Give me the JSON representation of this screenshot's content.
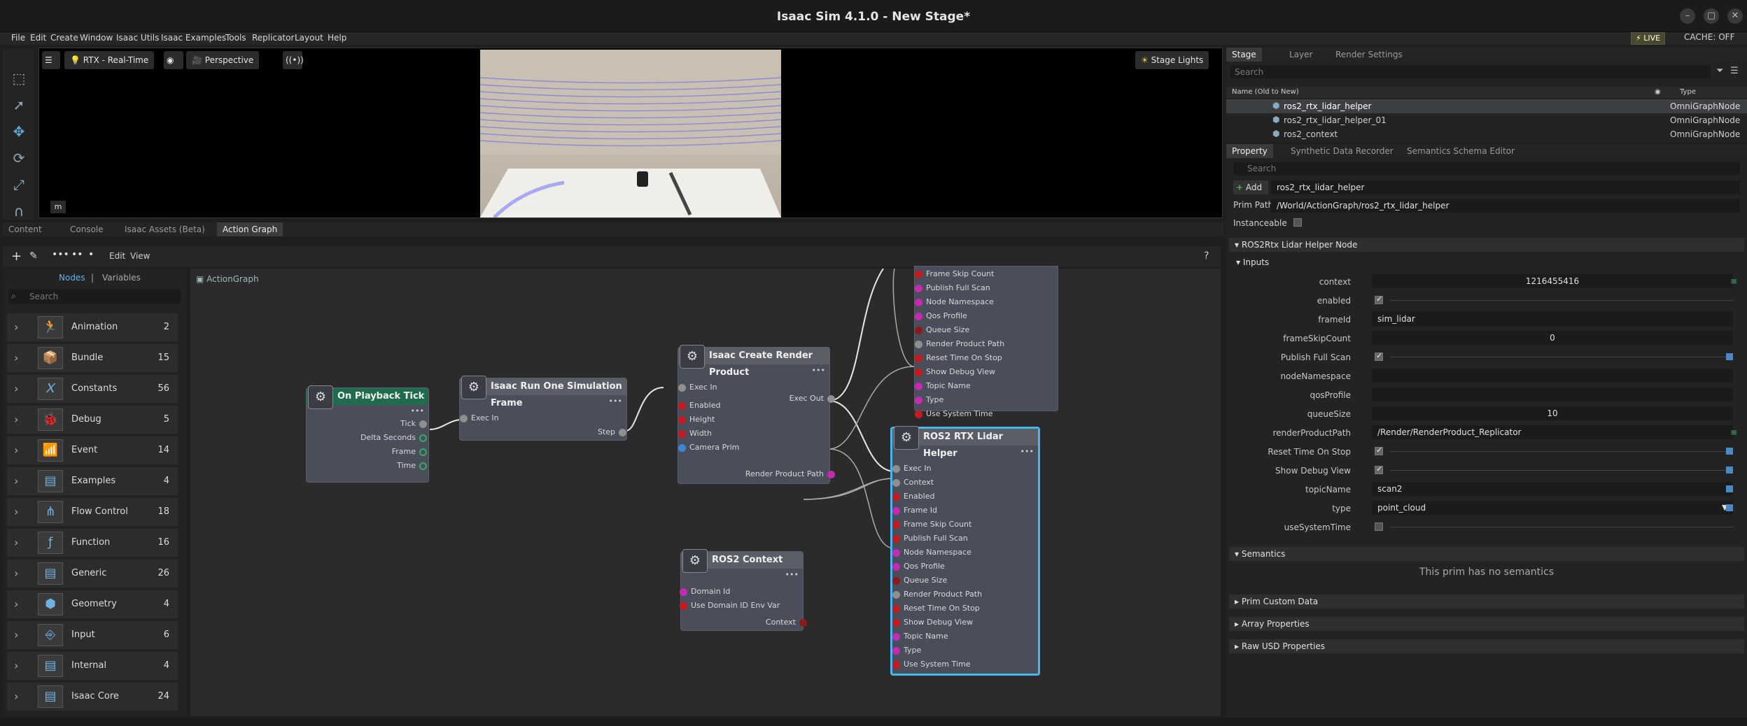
{
  "window": {
    "title": "Isaac Sim 4.1.0 - New Stage*"
  },
  "menu": [
    "File",
    "Edit",
    "Create",
    "Window",
    "Isaac Utils",
    "Isaac Examples",
    "Tools",
    "Replicator",
    "Layout",
    "Help"
  ],
  "status": {
    "live": "LIVE",
    "cache": "CACHE: OFF"
  },
  "viewport": {
    "render_mode": "RTX - Real-Time",
    "camera": "Perspective",
    "stage_lights": "Stage Lights",
    "units": "m"
  },
  "bottom_tabs": [
    "Content",
    "Console",
    "Isaac Assets (Beta)",
    "Action Graph"
  ],
  "graph": {
    "menus": [
      "Edit",
      "View"
    ],
    "lib_tabs": {
      "nodes": "Nodes",
      "vars": "Variables"
    },
    "search_placeholder": "Search",
    "breadcrumb": "ActionGraph",
    "help": "?",
    "categories": [
      {
        "name": "Animation",
        "count": "2"
      },
      {
        "name": "Bundle",
        "count": "15"
      },
      {
        "name": "Constants",
        "count": "56"
      },
      {
        "name": "Debug",
        "count": "5"
      },
      {
        "name": "Event",
        "count": "14"
      },
      {
        "name": "Examples",
        "count": "4"
      },
      {
        "name": "Flow Control",
        "count": "18"
      },
      {
        "name": "Function",
        "count": "16"
      },
      {
        "name": "Generic",
        "count": "26"
      },
      {
        "name": "Geometry",
        "count": "4"
      },
      {
        "name": "Input",
        "count": "6"
      },
      {
        "name": "Internal",
        "count": "4"
      },
      {
        "name": "Isaac Core",
        "count": "24"
      }
    ],
    "nodes": {
      "tick": {
        "title": "On Playback Tick",
        "outputs": [
          "Tick",
          "Delta Seconds",
          "Frame",
          "Time"
        ]
      },
      "sim": {
        "title": "Isaac Run One Simulation Frame",
        "inputs": [
          "Exec In"
        ],
        "outputs": [
          "Step"
        ]
      },
      "render": {
        "title": "Isaac Create Render Product",
        "inputs": [
          "Exec In",
          "Enabled",
          "Height",
          "Width",
          "Camera Prim"
        ],
        "outputs": [
          "Exec Out",
          "Render Product Path"
        ]
      },
      "ros2ctx": {
        "title": "ROS2 Context",
        "inputs": [
          "Domain Id",
          "Use Domain ID Env Var"
        ],
        "outputs": [
          "Context"
        ]
      },
      "lidar_top": {
        "inputs": [
          "Frame Skip Count",
          "Publish Full Scan",
          "Node Namespace",
          "Qos Profile",
          "Queue Size",
          "Render Product Path",
          "Reset Time On Stop",
          "Show Debug View",
          "Topic Name",
          "Type",
          "Use System Time"
        ]
      },
      "lidar": {
        "title": "ROS2 RTX Lidar Helper",
        "inputs": [
          "Exec In",
          "Context",
          "Enabled",
          "Frame Id",
          "Frame Skip Count",
          "Publish Full Scan",
          "Node Namespace",
          "Qos Profile",
          "Queue Size",
          "Render Product Path",
          "Reset Time On Stop",
          "Show Debug View",
          "Topic Name",
          "Type",
          "Use System Time"
        ]
      }
    }
  },
  "stage": {
    "tabs": [
      "Stage",
      "Layer",
      "Render Settings"
    ],
    "search_placeholder": "Search",
    "col_name": "Name (Old to New)",
    "col_type": "Type",
    "items": [
      {
        "name": "ros2_rtx_lidar_helper",
        "type": "OmniGraphNode"
      },
      {
        "name": "ros2_rtx_lidar_helper_01",
        "type": "OmniGraphNode"
      },
      {
        "name": "ros2_context",
        "type": "OmniGraphNode"
      }
    ]
  },
  "property": {
    "tabs": [
      "Property",
      "Synthetic Data Recorder",
      "Semantics Schema Editor"
    ],
    "search_placeholder": "Search",
    "add_label": "Add",
    "prim_name": "ros2_rtx_lidar_helper",
    "prim_path_label": "Prim Path",
    "prim_path": "/World/ActionGraph/ros2_rtx_lidar_helper",
    "instanceable_label": "Instanceable",
    "node_section": "ROS2Rtx Lidar Helper Node",
    "inputs_section": "Inputs",
    "fields": {
      "context": {
        "label": "context",
        "value": "1216455416"
      },
      "enabled": {
        "label": "enabled",
        "checked": true
      },
      "frameId": {
        "label": "frameId",
        "value": "sim_lidar"
      },
      "frameSkipCount": {
        "label": "frameSkipCount",
        "value": "0"
      },
      "publishFullScan": {
        "label": "Publish Full Scan",
        "checked": true
      },
      "nodeNamespace": {
        "label": "nodeNamespace",
        "value": ""
      },
      "qosProfile": {
        "label": "qosProfile",
        "value": ""
      },
      "queueSize": {
        "label": "queueSize",
        "value": "10"
      },
      "renderProductPath": {
        "label": "renderProductPath",
        "value": "/Render/RenderProduct_Replicator"
      },
      "resetTimeOnStop": {
        "label": "Reset Time On Stop",
        "checked": true
      },
      "showDebugView": {
        "label": "Show Debug View",
        "checked": true
      },
      "topicName": {
        "label": "topicName",
        "value": "scan2"
      },
      "type": {
        "label": "type",
        "value": "point_cloud"
      },
      "useSystemTime": {
        "label": "useSystemTime",
        "checked": false
      }
    },
    "semantics_section": "Semantics",
    "semantics_note": "This prim has no semantics",
    "collapsed": [
      "Prim Custom Data",
      "Array Properties",
      "Raw USD Properties"
    ]
  }
}
